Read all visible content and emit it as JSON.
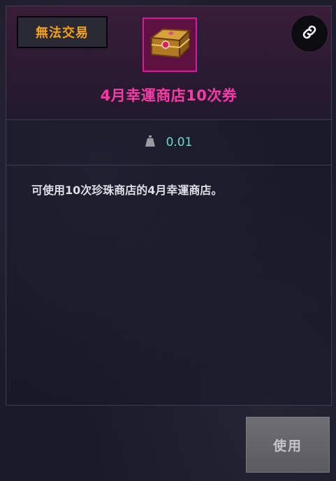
{
  "badge": {
    "label": "無法交易",
    "color": "#f3a21c"
  },
  "item": {
    "title": "4月幸運商店10次券",
    "icon": "treasure-chest-icon",
    "frame_color": "#e0169a",
    "title_color": "#ff3aa8"
  },
  "link_button": {
    "icon": "link-icon"
  },
  "weight": {
    "icon": "weight-icon",
    "value": "0.01"
  },
  "description": "可使用10次珍珠商店的4月幸運商店。",
  "use_button": {
    "label": "使用"
  }
}
